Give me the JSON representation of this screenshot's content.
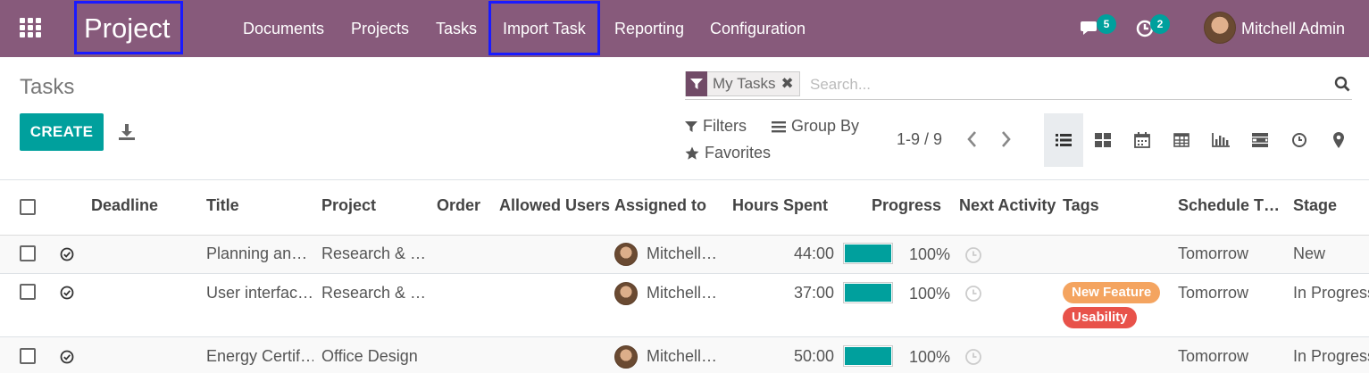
{
  "navbar": {
    "app_name": "Project",
    "menu": [
      "Documents",
      "Projects",
      "Tasks",
      "Import Task",
      "Reporting",
      "Configuration"
    ],
    "messages_count": "5",
    "activities_count": "2",
    "user_name": "Mitchell Admin",
    "brand_color": "#875a7b"
  },
  "control_panel": {
    "breadcrumb": "Tasks",
    "create_label": "CREATE",
    "search": {
      "facet_label": "My Tasks",
      "placeholder": "Search..."
    },
    "filters_label": "Filters",
    "groupby_label": "Group By",
    "favorites_label": "Favorites",
    "pager": "1-9 / 9",
    "views": [
      "list-icon",
      "kanban-icon",
      "calendar-icon",
      "pivot-icon",
      "graph-icon",
      "gantt-icon",
      "activity-icon",
      "map-icon"
    ],
    "active_view": "list"
  },
  "table": {
    "columns": [
      "Deadline",
      "Title",
      "Project",
      "Order",
      "Allowed Users",
      "Assigned to",
      "Hours Spent",
      "Progress",
      "Next Activity",
      "Tags",
      "Schedule T…",
      "Stage"
    ],
    "rows": [
      {
        "title": "Planning an…",
        "project": "Research & …",
        "assigned": "Mitchell…",
        "hours": "44:00",
        "progress": 1.0,
        "progress_label": "100%",
        "tags": [],
        "schedule": "Tomorrow",
        "stage": "New"
      },
      {
        "title": "User interfac…",
        "project": "Research & …",
        "assigned": "Mitchell…",
        "hours": "37:00",
        "progress": 1.0,
        "progress_label": "100%",
        "tags": [
          {
            "name": "New Feature",
            "color": "#f4a460"
          },
          {
            "name": "Usability",
            "color": "#e8524a"
          }
        ],
        "schedule": "Tomorrow",
        "stage": "In Progress"
      },
      {
        "title": "Energy Certif…",
        "project": "Office Design",
        "assigned": "Mitchell…",
        "hours": "50:00",
        "progress": 1.0,
        "progress_label": "100%",
        "tags": [],
        "schedule": "Tomorrow",
        "stage": "In Progress"
      }
    ],
    "accent_color": "#00a09d"
  }
}
